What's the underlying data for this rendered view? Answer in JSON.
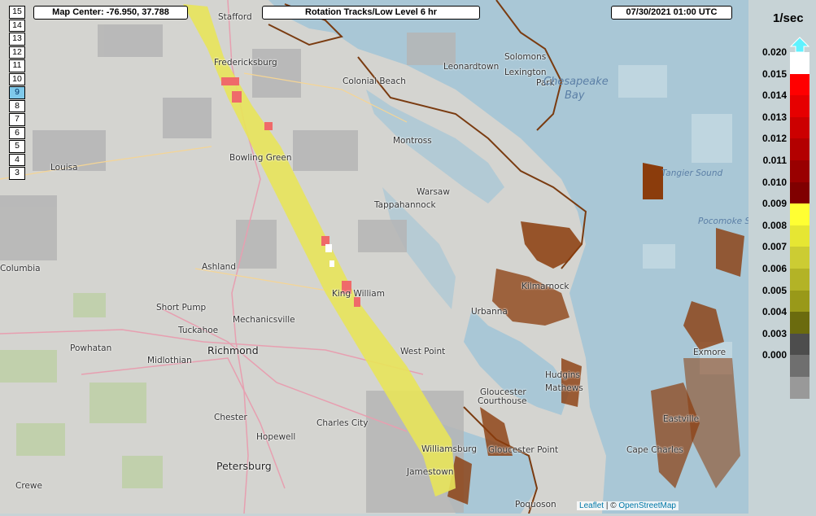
{
  "header": {
    "map_center": "Map Center: -76.950, 37.788",
    "layer_title": "Rotation Tracks/Low Level 6 hr",
    "timestamp": "07/30/2021   01:00 UTC"
  },
  "zoom": {
    "levels": [
      "15",
      "14",
      "13",
      "12",
      "11",
      "10",
      "9",
      "8",
      "7",
      "6",
      "5",
      "4",
      "3"
    ],
    "active": "9"
  },
  "legend": {
    "unit": "1/sec",
    "ticks": [
      "0.020",
      "0.015",
      "0.014",
      "0.013",
      "0.012",
      "0.011",
      "0.010",
      "0.009",
      "0.008",
      "0.007",
      "0.006",
      "0.005",
      "0.004",
      "0.003",
      "0.000"
    ],
    "colors": [
      "#ffffff",
      "#ff0000",
      "#e60000",
      "#cc0000",
      "#b30000",
      "#990000",
      "#800000",
      "#ffff33",
      "#e6e633",
      "#cccc33",
      "#b3b326",
      "#999919",
      "#6b6b0e",
      "#4d4d4d",
      "#6f6f6f",
      "#999999"
    ],
    "arrow_color": "#5ff2ff"
  },
  "places": [
    {
      "name": "Stafford",
      "cls": ""
    },
    {
      "name": "Fredericksburg",
      "cls": ""
    },
    {
      "name": "Colonial Beach",
      "cls": ""
    },
    {
      "name": "Leonardtown",
      "cls": ""
    },
    {
      "name": "Solomons",
      "cls": ""
    },
    {
      "name": "Lexington",
      "cls": ""
    },
    {
      "name": "Park",
      "cls": ""
    },
    {
      "name": "Chesapeake",
      "cls": "water"
    },
    {
      "name": "Bay",
      "cls": "water"
    },
    {
      "name": "Bowling Green",
      "cls": ""
    },
    {
      "name": "Montross",
      "cls": ""
    },
    {
      "name": "Louisa",
      "cls": ""
    },
    {
      "name": "Warsaw",
      "cls": ""
    },
    {
      "name": "Tappahannock",
      "cls": ""
    },
    {
      "name": "Ashland",
      "cls": ""
    },
    {
      "name": "Columbia",
      "cls": ""
    },
    {
      "name": "King William",
      "cls": ""
    },
    {
      "name": "Short Pump",
      "cls": ""
    },
    {
      "name": "Tuckahoe",
      "cls": ""
    },
    {
      "name": "Mechanicsville",
      "cls": ""
    },
    {
      "name": "Powhatan",
      "cls": ""
    },
    {
      "name": "Richmond",
      "cls": "big"
    },
    {
      "name": "Midlothian",
      "cls": ""
    },
    {
      "name": "Urbanna",
      "cls": ""
    },
    {
      "name": "Kilmarnock",
      "cls": ""
    },
    {
      "name": "Exmore",
      "cls": ""
    },
    {
      "name": "West Point",
      "cls": ""
    },
    {
      "name": "Hudgins",
      "cls": ""
    },
    {
      "name": "Mathews",
      "cls": ""
    },
    {
      "name": "Gloucester",
      "cls": ""
    },
    {
      "name": "Courthouse",
      "cls": ""
    },
    {
      "name": "Chester",
      "cls": ""
    },
    {
      "name": "Charles City",
      "cls": ""
    },
    {
      "name": "Hopewell",
      "cls": ""
    },
    {
      "name": "Williamsburg",
      "cls": ""
    },
    {
      "name": "Gloucester Point",
      "cls": ""
    },
    {
      "name": "Jamestown",
      "cls": ""
    },
    {
      "name": "Eastville",
      "cls": ""
    },
    {
      "name": "Cape Charles",
      "cls": ""
    },
    {
      "name": "Petersburg",
      "cls": "big"
    },
    {
      "name": "Crewe",
      "cls": ""
    },
    {
      "name": "Poquoson",
      "cls": ""
    },
    {
      "name": "Pocomoke Sound",
      "cls": "water"
    },
    {
      "name": "Tangier Sound",
      "cls": "water"
    }
  ],
  "attribution": {
    "prefix": "Leaflet",
    "sep": " | © ",
    "osm": "OpenStreetMap"
  }
}
